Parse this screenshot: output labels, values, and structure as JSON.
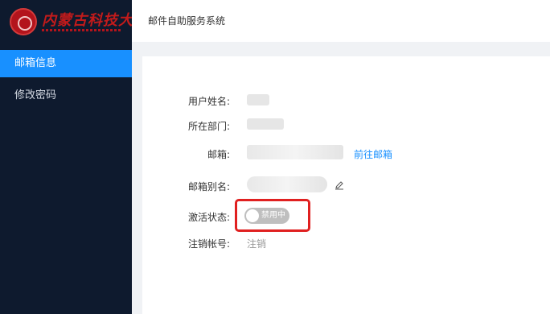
{
  "brand": {
    "logo_text": "内蒙古科技大学"
  },
  "header": {
    "title": "邮件自助服务系统"
  },
  "sidebar": {
    "items": [
      {
        "label": "邮箱信息",
        "active": true
      },
      {
        "label": "修改密码",
        "active": false
      }
    ]
  },
  "info": {
    "name_label": "用户姓名:",
    "dept_label": "所在部门:",
    "email_label": "邮箱:",
    "goto_mailbox": "前往邮箱",
    "alias_label": "邮箱别名:",
    "status_label": "激活状态:",
    "status_value": "禁用中",
    "status_on": false,
    "cancel_label": "注销帐号:",
    "cancel_action": "注销"
  },
  "colors": {
    "sidebar_bg": "#0e1a2e",
    "accent": "#1890ff",
    "highlight_border": "#e02020"
  }
}
